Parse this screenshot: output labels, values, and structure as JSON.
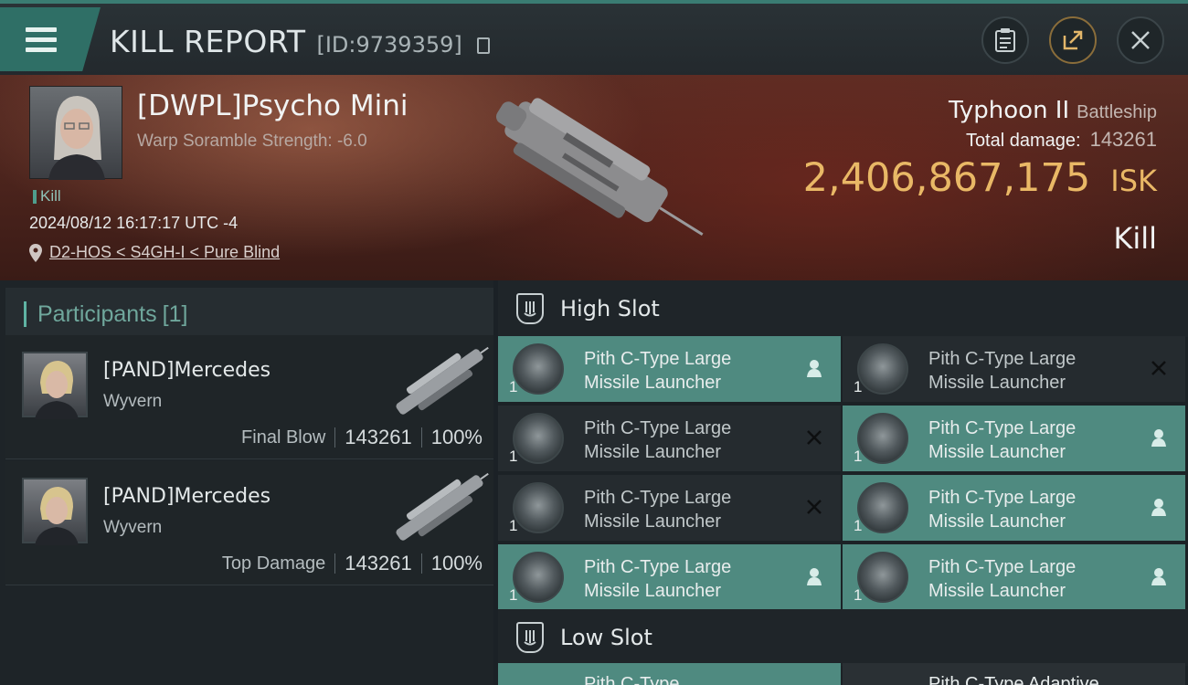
{
  "header": {
    "title": "KILL REPORT",
    "report_id": "[ID:9739359]",
    "icons": [
      "menu-icon",
      "copy-icon",
      "clipboard-icon",
      "share-icon",
      "close-icon"
    ]
  },
  "victim": {
    "pilot": "[DWPL]Psycho Mini",
    "scramble": "Warp Soramble Strength: -6.0",
    "tag": "Kill",
    "datetime": "2024/08/12 16:17:17 UTC -4",
    "location": "D2-HOS < S4GH-I < Pure Blind",
    "ship_name": "Typhoon II",
    "ship_class": "Battleship",
    "total_damage_label": "Total damage:",
    "total_damage": "143261",
    "isk_value": "2,406,867,175",
    "isk_unit": "ISK",
    "result": "Kill"
  },
  "participants": {
    "label": "Participants",
    "count": "[1]",
    "rows": [
      {
        "name": "[PAND]Mercedes",
        "ship": "Wyvern",
        "role": "Final Blow",
        "damage": "143261",
        "percent": "100%"
      },
      {
        "name": "[PAND]Mercedes",
        "ship": "Wyvern",
        "role": "Top Damage",
        "damage": "143261",
        "percent": "100%"
      }
    ]
  },
  "high_slot": {
    "label": "High Slot",
    "modules": [
      {
        "line1": "Pith C-Type Large",
        "line2": "Missile Launcher",
        "qty": "1",
        "state": "dropped"
      },
      {
        "line1": "Pith C-Type Large",
        "line2": "Missile Launcher",
        "qty": "1",
        "state": "destroyed"
      },
      {
        "line1": "Pith C-Type Large",
        "line2": "Missile Launcher",
        "qty": "1",
        "state": "destroyed"
      },
      {
        "line1": "Pith C-Type Large",
        "line2": "Missile Launcher",
        "qty": "1",
        "state": "dropped"
      },
      {
        "line1": "Pith C-Type Large",
        "line2": "Missile Launcher",
        "qty": "1",
        "state": "destroyed"
      },
      {
        "line1": "Pith C-Type Large",
        "line2": "Missile Launcher",
        "qty": "1",
        "state": "dropped"
      },
      {
        "line1": "Pith C-Type Large",
        "line2": "Missile Launcher",
        "qty": "1",
        "state": "dropped"
      },
      {
        "line1": "Pith C-Type Large",
        "line2": "Missile Launcher",
        "qty": "1",
        "state": "dropped"
      }
    ]
  },
  "low_slot": {
    "label": "Low Slot",
    "peek": [
      {
        "text": "Pith C-Type",
        "state": "dropped"
      },
      {
        "text": "Pith C-Type Adaptive",
        "state": "destroyed"
      }
    ]
  },
  "colors": {
    "accent": "#3a7c72",
    "dropped": "#4f8a80",
    "destroyed": "#252b2f",
    "isk": "#e9b866"
  }
}
